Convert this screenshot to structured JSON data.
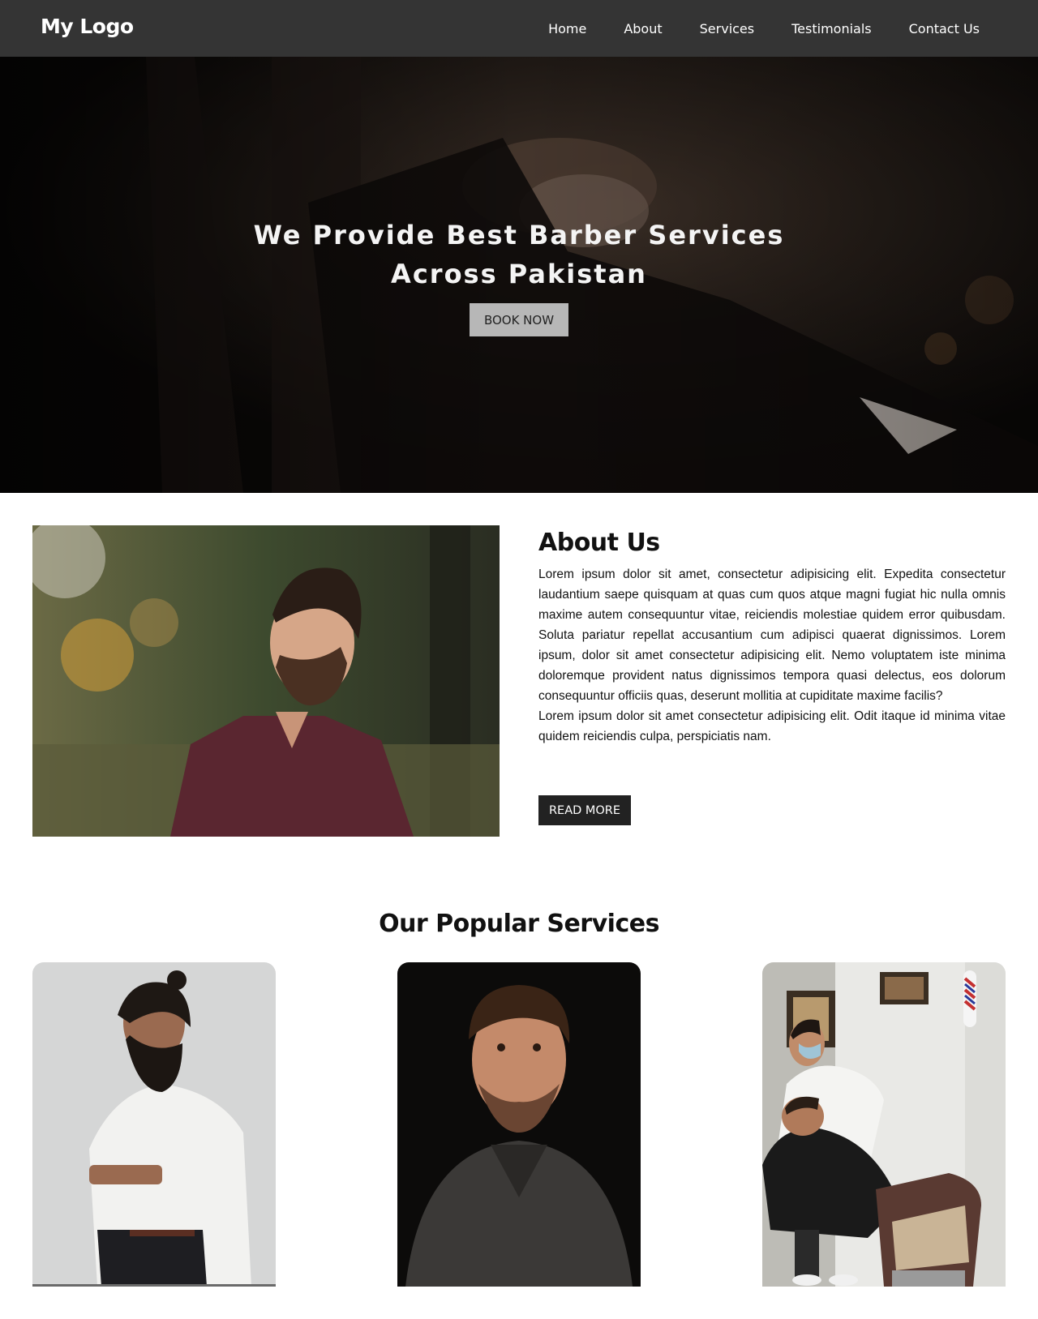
{
  "nav": {
    "logo": "My Logo",
    "links": [
      "Home",
      "About",
      "Services",
      "Testimonials",
      "Contact Us"
    ]
  },
  "hero": {
    "title_line1": "We Provide Best Barber Services",
    "title_line2": "Across Pakistan",
    "button": "BOOK NOW"
  },
  "about": {
    "title": "About Us",
    "paragraph1": "Lorem ipsum dolor sit amet, consectetur adipisicing elit. Expedita consectetur laudantium saepe quisquam at quas cum quos atque magni fugiat hic nulla omnis maxime autem consequuntur vitae, reiciendis molestiae quidem error quibusdam. Soluta pariatur repellat accusantium cum adipisci quaerat dignissimos. Lorem ipsum, dolor sit amet consectetur adipisicing elit. Nemo voluptatem iste minima doloremque provident natus dignissimos tempora quasi delectus, eos dolorum consequuntur officiis quas, deserunt mollitia at cupiditate maxime facilis?",
    "paragraph2": "Lorem ipsum dolor sit amet consectetur adipisicing elit. Odit itaque id minima vitae quidem reiciendis culpa, perspiciatis nam.",
    "button": "READ MORE"
  },
  "services": {
    "title": "Our Popular Services"
  },
  "colors": {
    "nav_bg": "#343434",
    "hero_button_bg": "#b7b7b7",
    "dark_button_bg": "#222222"
  }
}
